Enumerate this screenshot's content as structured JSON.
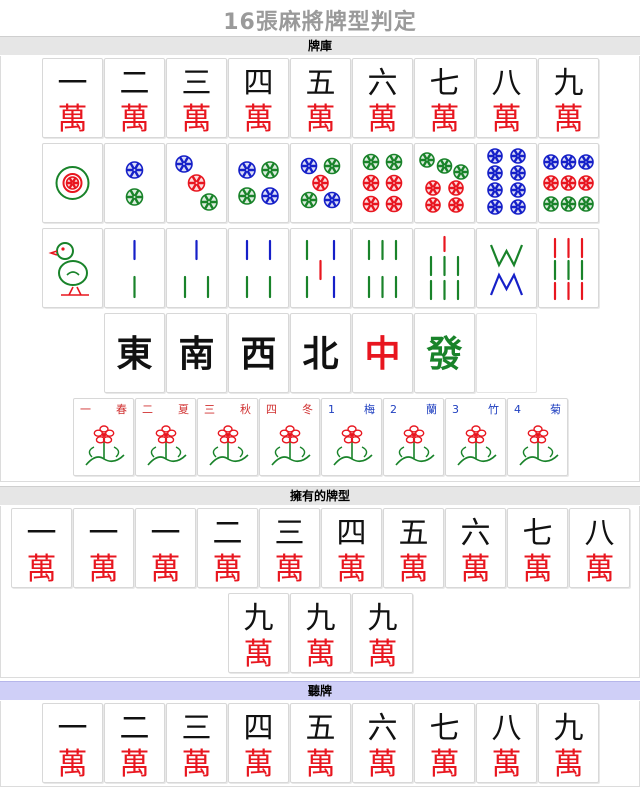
{
  "title": "16張麻將牌型判定",
  "sections": {
    "library": "牌庫",
    "owned": "擁有的牌型",
    "waiting": "聽牌"
  },
  "numerals": [
    "一",
    "二",
    "三",
    "四",
    "五",
    "六",
    "七",
    "八",
    "九"
  ],
  "wan": "萬",
  "honors": [
    "東",
    "南",
    "西",
    "北",
    "中",
    "發"
  ],
  "flowers": [
    {
      "num": "一",
      "name": "春",
      "color": "#d03030"
    },
    {
      "num": "二",
      "name": "夏",
      "color": "#d03030"
    },
    {
      "num": "三",
      "name": "秋",
      "color": "#d03030"
    },
    {
      "num": "四",
      "name": "冬",
      "color": "#d03030"
    },
    {
      "num": "1",
      "name": "梅",
      "color": "#2040c0"
    },
    {
      "num": "2",
      "name": "蘭",
      "color": "#2040c0"
    },
    {
      "num": "3",
      "name": "竹",
      "color": "#2040c0"
    },
    {
      "num": "4",
      "name": "菊",
      "color": "#2040c0"
    }
  ],
  "owned_tiles": [
    "一",
    "一",
    "一",
    "二",
    "三",
    "四",
    "五",
    "六",
    "七",
    "八",
    "九",
    "九",
    "九"
  ],
  "waiting_tiles": [
    "一",
    "二",
    "三",
    "四",
    "五",
    "六",
    "七",
    "八",
    "九"
  ],
  "colors": {
    "red": "#e8161f",
    "green": "#19832a",
    "blue": "#1620c8",
    "black": "#111111"
  }
}
